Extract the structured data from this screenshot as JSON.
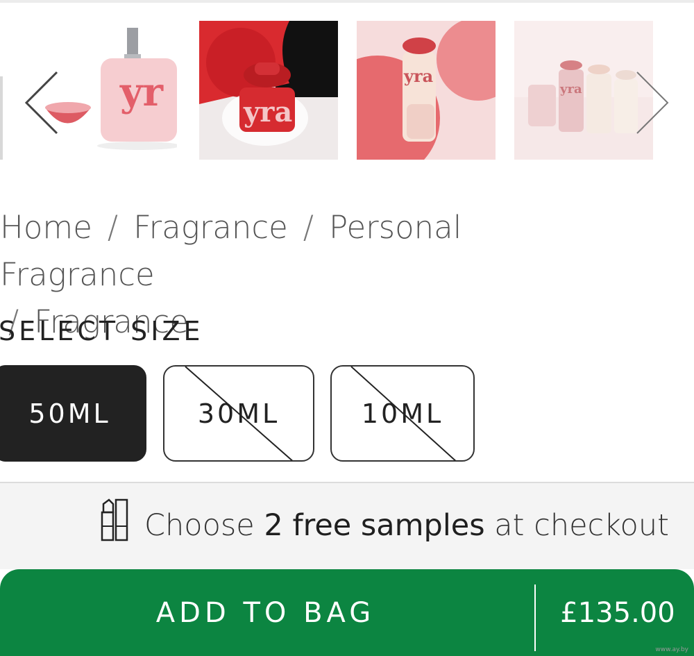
{
  "carousel": {
    "thumbnails": [
      {
        "icon": "perfume-bottle-with-cap-thumbnail"
      },
      {
        "icon": "red-perfume-closeup-thumbnail"
      },
      {
        "icon": "perfume-held-by-hands-thumbnail"
      },
      {
        "icon": "perfume-bottles-group-thumbnail"
      }
    ],
    "prev_icon": "chevron-left-icon",
    "next_icon": "chevron-right-icon"
  },
  "breadcrumb": {
    "items": [
      "Home",
      "Fragrance",
      "Personal Fragrance",
      "Fragrance"
    ],
    "separator": "/"
  },
  "size_selector": {
    "heading": "SELECT SIZE",
    "options": [
      {
        "label": "50ML",
        "selected": true,
        "available": true
      },
      {
        "label": "30ML",
        "selected": false,
        "available": false
      },
      {
        "label": "10ML",
        "selected": false,
        "available": false
      }
    ]
  },
  "samples": {
    "icon": "samples-lipstick-icon",
    "text_before": "Choose ",
    "text_bold": "2 free samples",
    "text_after": " at checkout"
  },
  "add_to_bag": {
    "label": "ADD TO BAG",
    "price": "£135.00"
  },
  "watermark": "www.ay.by",
  "colors": {
    "accent_green": "#0c8541",
    "selected_dark": "#222222",
    "product_red": "#d92a2f",
    "product_pink": "#f2b3b8"
  }
}
